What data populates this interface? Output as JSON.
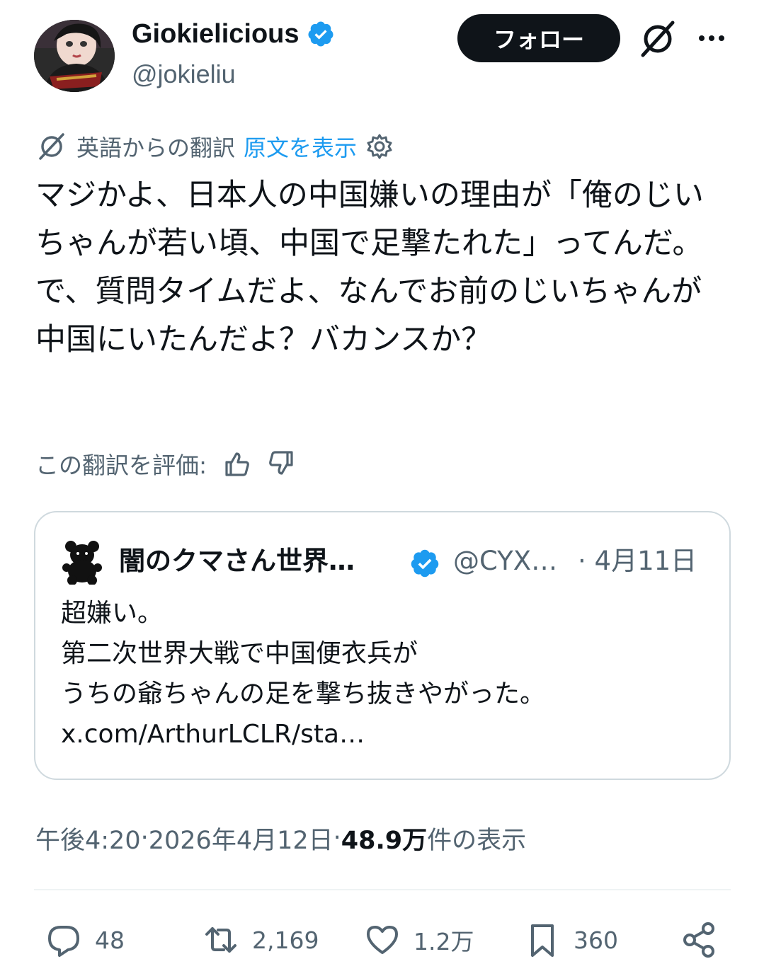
{
  "author": {
    "display_name": "Giokielicious",
    "handle": "@jokieliu",
    "verified": true
  },
  "follow_button": {
    "label": "フォロー"
  },
  "translation": {
    "label": "英語からの翻訳",
    "show_original": "原文を表示"
  },
  "tweet": {
    "text": "マジかよ、日本人の中国嫌いの理由が「俺のじいちゃんが若い頃、中国で足撃たれた」ってんだ。で、質問タイムだよ、なんでお前のじいちゃんが中国にいたんだよ？バカンスか？"
  },
  "rate_translation": {
    "label": "この翻訳を評価:"
  },
  "quoted_tweet": {
    "display_name": "闇のクマさん世界…",
    "handle": "@CYX…",
    "date": "· 4月11日",
    "verified": true,
    "lines": [
      "超嫌い。",
      "第二次世界大戦で中国便衣兵が",
      "うちの爺ちゃんの足を撃ち抜きやがった。",
      "x.com/ArthurLCLR/sta…"
    ]
  },
  "meta": {
    "time": "午後4:20",
    "separator": " · ",
    "date": "2026年4月12日",
    "views_count": "48.9万",
    "views_label": " 件の表示"
  },
  "actions": {
    "replies": "48",
    "reposts": "2,169",
    "likes": "1.2万",
    "bookmarks": "360"
  },
  "colors": {
    "text": "#0f1419",
    "secondary": "#536471",
    "accent": "#1d9bf0",
    "border": "#cfd9de"
  }
}
